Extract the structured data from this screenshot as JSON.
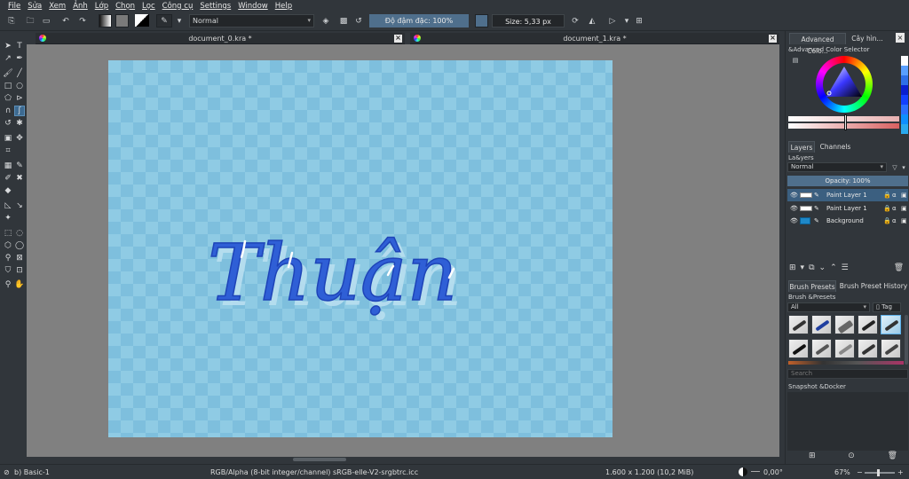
{
  "menu": [
    "File",
    "Sửa",
    "Xem",
    "Ảnh",
    "Lớp",
    "Chọn",
    "Lọc",
    "Công cụ",
    "Settings",
    "Window",
    "Help"
  ],
  "toolbar": {
    "blend_mode": "Normal",
    "opacity_label": "Độ đậm đặc: 100%",
    "size_label": "Size: 5,33 px"
  },
  "documents": [
    {
      "title": "document_0.kra *"
    },
    {
      "title": "document_1.kra *"
    }
  ],
  "dock": {
    "color_tabs": [
      "Advanced Colo...",
      "Cây hìn..."
    ],
    "color_selector_title": "&Advanced Color Selector",
    "layer_tabs": [
      "Layers",
      "Channels"
    ],
    "layers_title": "La&yers",
    "layer_blend": "Normal",
    "layer_opacity": "Opacity:  100%",
    "layers": [
      {
        "name": "Paint Layer 1",
        "selected": true
      },
      {
        "name": "Paint Layer 1",
        "selected": false
      },
      {
        "name": "Background",
        "selected": false
      }
    ],
    "brush_tabs": [
      "Brush Presets",
      "Brush Preset History"
    ],
    "brush_title": "Brush &Presets",
    "brush_filter": "All",
    "brush_tag": "Tag",
    "search_placeholder": "Search",
    "snapshot_title": "Snapshot &Docker"
  },
  "canvas": {
    "text": "Thuận"
  },
  "status": {
    "brush": "b) Basic-1",
    "color_space": "RGB/Alpha (8-bit integer/channel)  sRGB-elle-V2-srgbtrc.icc",
    "dimensions": "1.600 x 1.200 (10,2 MiB)",
    "rotation": "0,00°",
    "zoom": "67%"
  },
  "colors": {
    "accent": "#3b5f80",
    "canvas_bg": "#8fcbe4",
    "ink": "#2f5fd6"
  }
}
